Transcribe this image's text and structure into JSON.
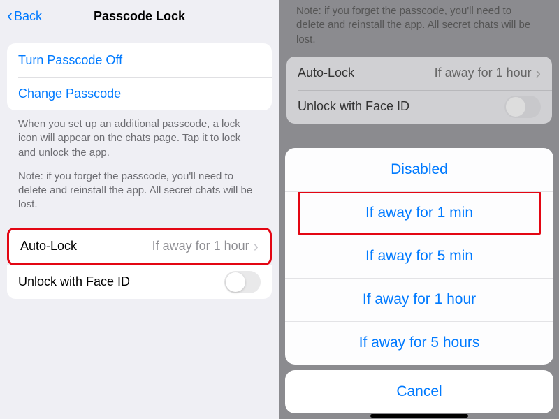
{
  "left": {
    "back": "Back",
    "title": "Passcode Lock",
    "actions": {
      "turn_off": "Turn Passcode Off",
      "change": "Change Passcode"
    },
    "footer": {
      "p1": "When you set up an additional passcode, a lock icon will appear on the chats page. Tap it to lock and unlock the app.",
      "p2": "Note: if you forget the passcode, you'll need to delete and reinstall the app. All secret chats will be lost."
    },
    "autolock": {
      "label": "Auto-Lock",
      "value": "If away for 1 hour"
    },
    "faceid": {
      "label": "Unlock with Face ID"
    }
  },
  "right": {
    "note": "Note: if you forget the passcode, you'll need to delete and reinstall the app. All secret chats will be lost.",
    "autolock": {
      "label": "Auto-Lock",
      "value": "If away for 1 hour"
    },
    "faceid": {
      "label": "Unlock with Face ID"
    },
    "sheet": {
      "opt0": "Disabled",
      "opt1": "If away for 1 min",
      "opt2": "If away for 5 min",
      "opt3": "If away for 1 hour",
      "opt4": "If away for 5 hours",
      "cancel": "Cancel"
    }
  }
}
